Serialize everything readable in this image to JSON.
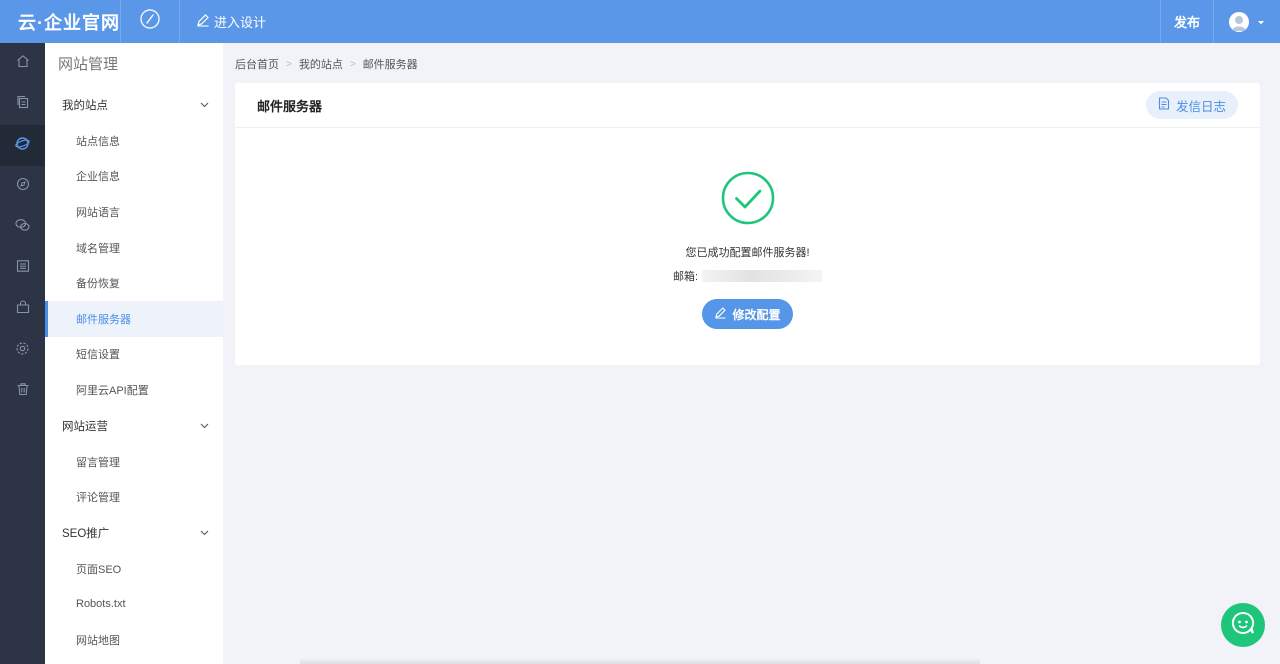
{
  "topbar": {
    "logo": "云·企业官网",
    "design_label": "进入设计",
    "publish_label": "发布"
  },
  "sidebar": {
    "title": "网站管理",
    "groups": [
      {
        "label": "我的站点",
        "items": [
          "站点信息",
          "企业信息",
          "网站语言",
          "域名管理",
          "备份恢复",
          "邮件服务器",
          "短信设置",
          "阿里云API配置"
        ]
      },
      {
        "label": "网站运营",
        "items": [
          "留言管理",
          "评论管理"
        ]
      },
      {
        "label": "SEO推广",
        "items": [
          "页面SEO",
          "Robots.txt",
          "网站地图"
        ]
      }
    ],
    "active_item": "邮件服务器"
  },
  "breadcrumb": [
    "后台首页",
    "我的站点",
    "邮件服务器"
  ],
  "card": {
    "title": "邮件服务器",
    "log_button": "发信日志",
    "success_message": "您已成功配置邮件服务器!",
    "email_label": "邮箱:",
    "edit_button": "修改配置"
  },
  "colors": {
    "topbar": "#5a97e8",
    "rail": "#2c3446",
    "accent": "#4a8de6",
    "success": "#1dc67a"
  },
  "icons": {
    "rail": [
      "home-icon",
      "copy-icon",
      "globe-icon",
      "compass-icon",
      "wechat-icon",
      "list-icon",
      "shop-icon",
      "settings-icon",
      "trash-icon"
    ],
    "chat": "chat-support-icon"
  }
}
